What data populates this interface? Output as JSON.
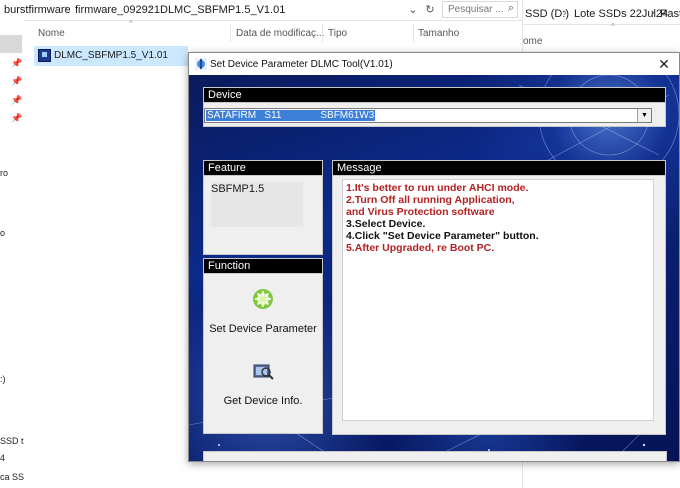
{
  "explorer": {
    "breadcrumbs": [
      "burstfirmware",
      "firmware_092921",
      "DLMC_SBFMP1.5_V1.01"
    ],
    "search_placeholder": "Pesquisar ...",
    "columns": [
      "Nome",
      "Data de modificaç...",
      "Tipo",
      "Tamanho"
    ],
    "file_name": "DLMC_SBFMP1.5_V1.01",
    "left_pane_texts": [
      "ro",
      "o",
      ":)",
      "SSD t",
      "4",
      "ca SS"
    ]
  },
  "explorer2": {
    "breadcrumbs": [
      "SSD (D:)",
      "Lote SSDs 22Jul24",
      "Pasta"
    ],
    "column": "ome"
  },
  "dialog": {
    "title": "Set Device Parameter DLMC Tool(V1.01)",
    "device_header": "Device",
    "device_value": "SATAFIRM   S11              SBFM61W3",
    "feature_header": "Feature",
    "feature_value": "SBFMP1.5",
    "function_header": "Function",
    "set_param_label": "Set Device Parameter",
    "get_info_label": "Get Device Info.",
    "message_header": "Message",
    "messages": [
      {
        "text": "1.It's better to run under AHCI mode.",
        "color": "#b22222"
      },
      {
        "text": "2.Turn Off all running Application,",
        "color": "#b22222"
      },
      {
        "text": "   and Virus Protection software",
        "color": "#b22222"
      },
      {
        "text": "3.Select Device.",
        "color": "#111111"
      },
      {
        "text": "4.Click \"Set Device Parameter\" button.",
        "color": "#111111"
      },
      {
        "text": "5.After Upgraded, re Boot PC.",
        "color": "#b22222"
      }
    ],
    "icons": {
      "app": "app-icon",
      "set_param": "gear-spark-icon",
      "get_info": "device-magnify-icon"
    }
  }
}
